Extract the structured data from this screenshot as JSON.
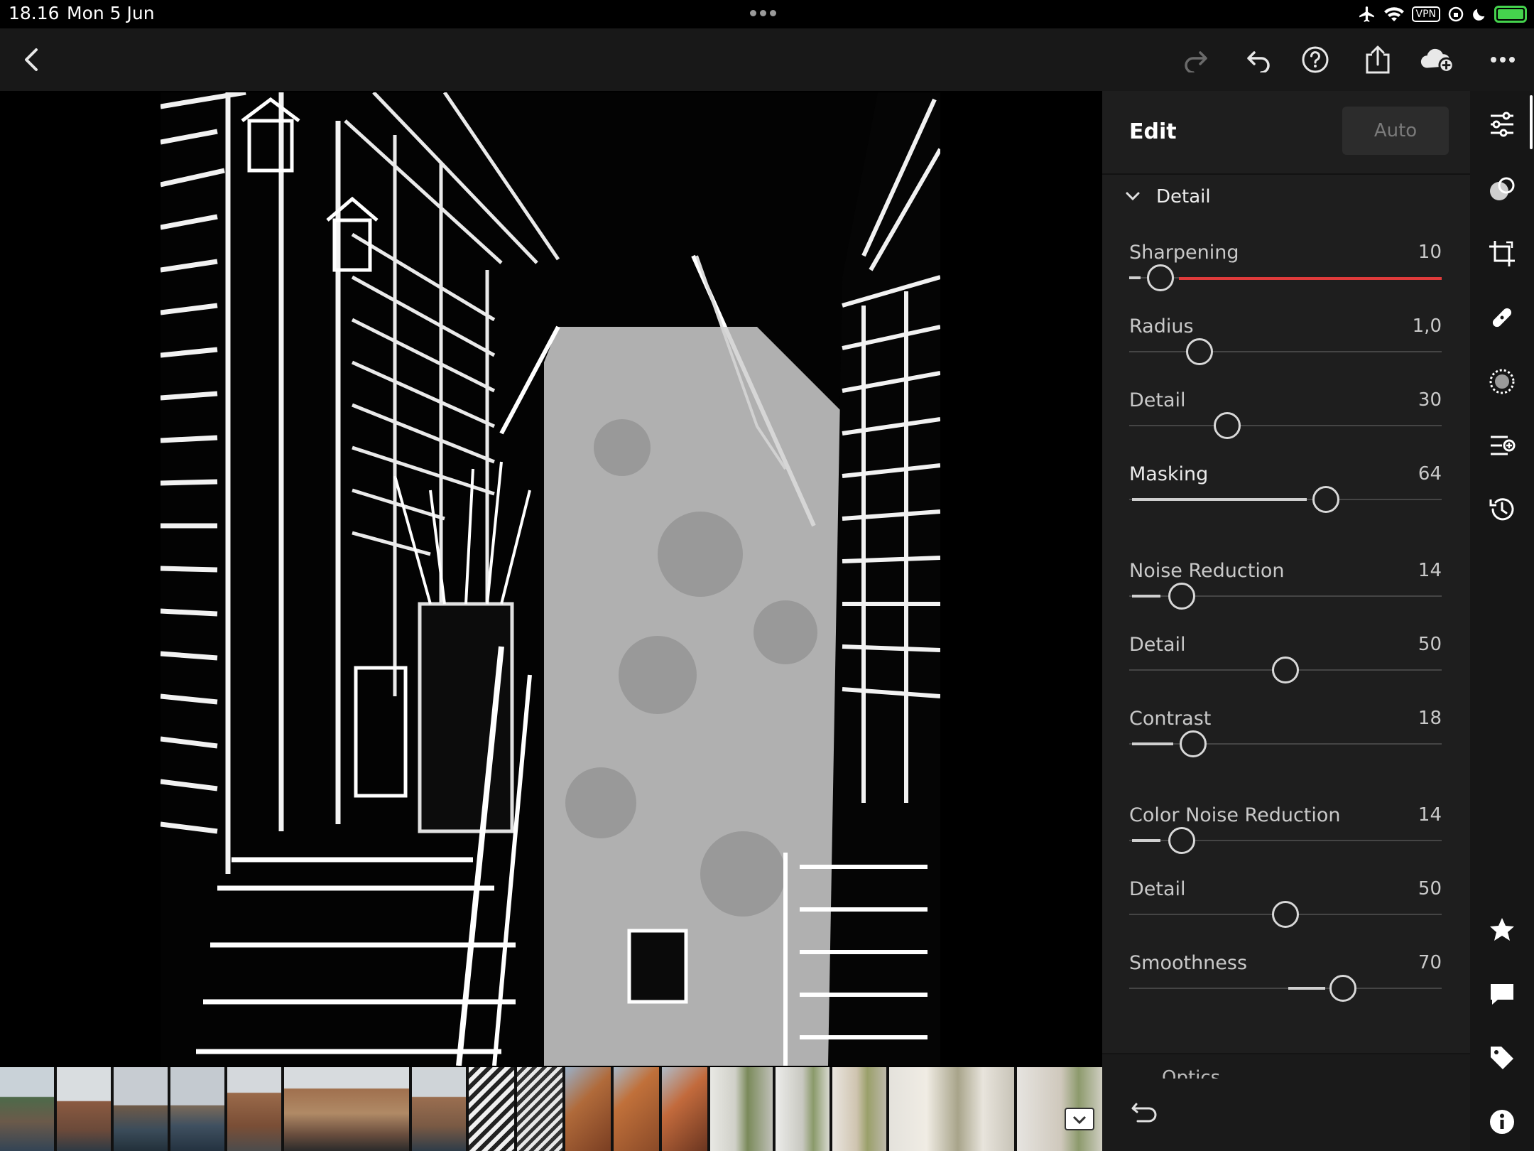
{
  "status_bar": {
    "time": "18.16",
    "date": "Mon 5 Jun",
    "vpn": "VPN"
  },
  "panel": {
    "title": "Edit",
    "auto_label": "Auto",
    "section": "Detail",
    "sliders": [
      {
        "label": "Sharpening",
        "value": "10",
        "fraction": 0.1
      },
      {
        "label": "Radius",
        "value": "1,0",
        "fraction": 0.225
      },
      {
        "label": "Detail",
        "value": "30",
        "fraction": 0.31
      },
      {
        "label": "Masking",
        "value": "64",
        "fraction": 0.64
      },
      {
        "label": "Noise Reduction",
        "value": "14",
        "fraction": 0.17
      },
      {
        "label": "Detail",
        "value": "50",
        "fraction": 0.5
      },
      {
        "label": "Contrast",
        "value": "18",
        "fraction": 0.205
      },
      {
        "label": "Color Noise Reduction",
        "value": "14",
        "fraction": 0.17
      },
      {
        "label": "Detail",
        "value": "50",
        "fraction": 0.5
      },
      {
        "label": "Smoothness",
        "value": "70",
        "fraction": 0.69
      }
    ],
    "next_section": "Optics"
  },
  "toolbar_icons": [
    "back-icon",
    "redo-icon",
    "undo-icon",
    "help-icon",
    "share-icon",
    "cloud-add-icon",
    "more-icon"
  ],
  "rail_icons": [
    "edit-sliders-icon",
    "presets-icon",
    "crop-icon",
    "healing-icon",
    "masking-icon",
    "versions-icon",
    "history-icon",
    "rating-star-icon",
    "comment-icon",
    "tag-icon",
    "info-icon"
  ],
  "colors": {
    "panel": "#1e1e1e",
    "accent_red": "#e03b3b",
    "battery": "#45d34d"
  }
}
